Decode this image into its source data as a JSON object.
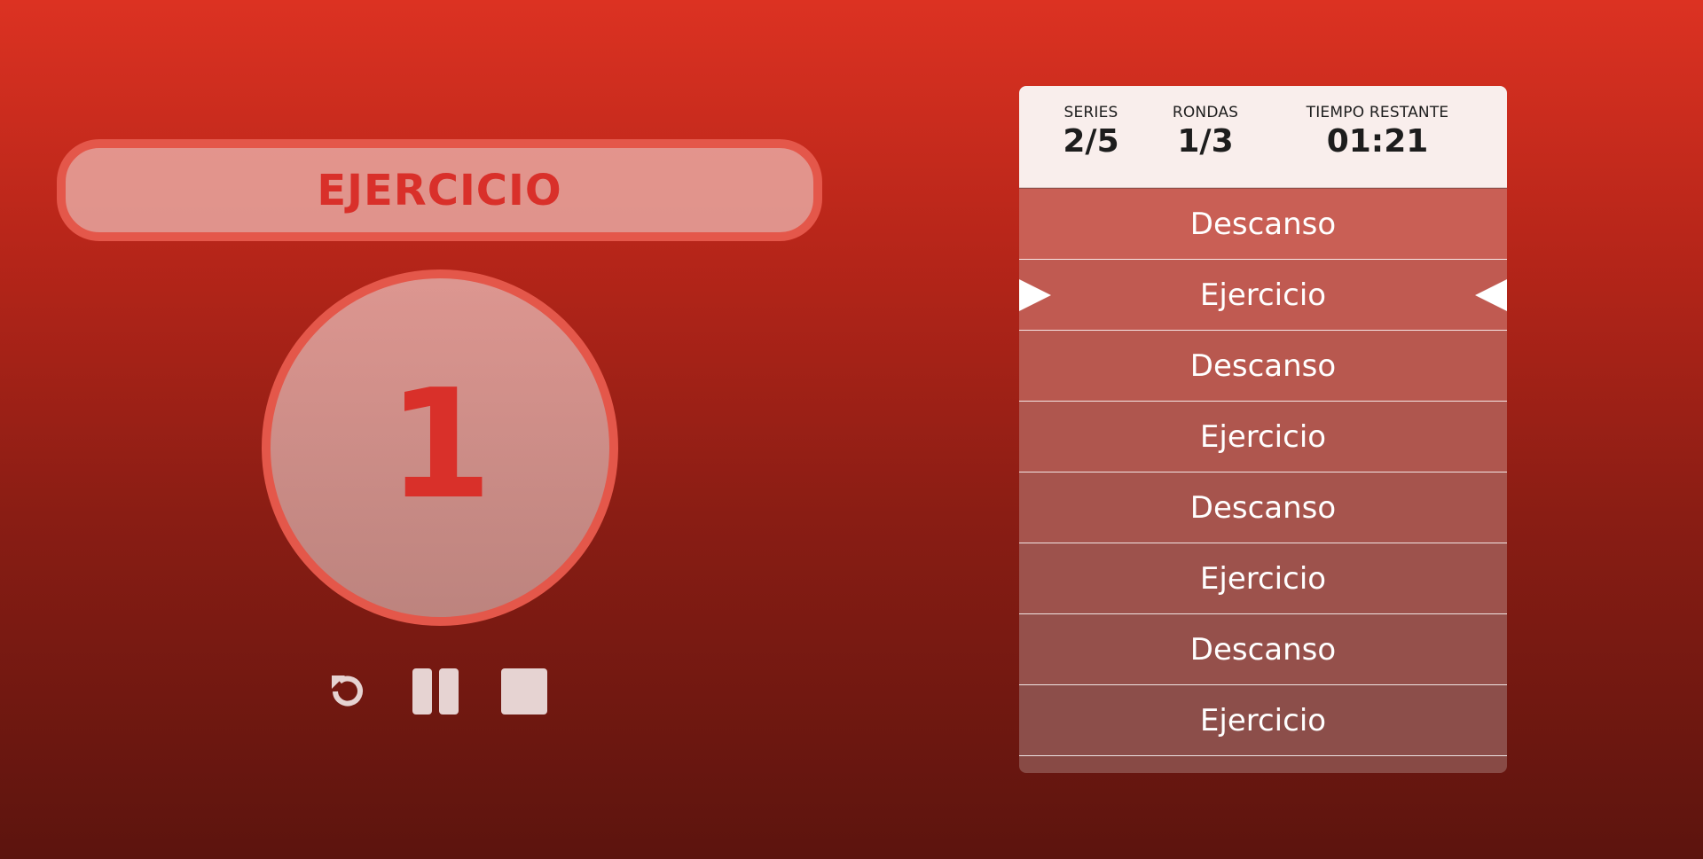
{
  "phase": {
    "label": "EJERCICIO"
  },
  "countdown": {
    "value": "1"
  },
  "controls": [
    {
      "name": "restart-icon"
    },
    {
      "name": "pause-icon"
    },
    {
      "name": "stop-icon"
    }
  ],
  "stats": {
    "series": {
      "label": "SERIES",
      "value": "2/5"
    },
    "rounds": {
      "label": "RONDAS",
      "value": "1/3"
    },
    "time_left": {
      "label": "TIEMPO RESTANTE",
      "value": "01:21"
    }
  },
  "schedule": [
    {
      "label": "Descanso",
      "active": false
    },
    {
      "label": "Ejercicio",
      "active": true
    },
    {
      "label": "Descanso",
      "active": false
    },
    {
      "label": "Ejercicio",
      "active": false
    },
    {
      "label": "Descanso",
      "active": false
    },
    {
      "label": "Ejercicio",
      "active": false
    },
    {
      "label": "Descanso",
      "active": false
    },
    {
      "label": "Ejercicio",
      "active": false
    }
  ],
  "colors": {
    "accent": "#d9302a",
    "ring": "#e4574a",
    "icon": "#e6d3d2"
  }
}
